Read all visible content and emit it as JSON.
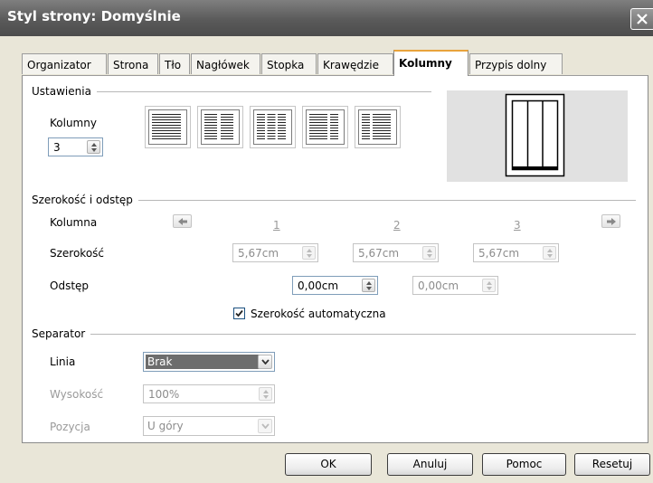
{
  "window": {
    "title": "Styl strony: Domyślnie"
  },
  "tabs": [
    {
      "label": "Organizator"
    },
    {
      "label": "Strona"
    },
    {
      "label": "Tło"
    },
    {
      "label": "Nagłówek"
    },
    {
      "label": "Stopka"
    },
    {
      "label": "Krawędzie"
    },
    {
      "label": "Kolumny",
      "active": true
    },
    {
      "label": "Przypis dolny"
    }
  ],
  "settings": {
    "section": "Ustawienia",
    "columns_label": "Kolumny",
    "columns_value": "3",
    "presets": [
      "1 column",
      "2 columns",
      "3 columns",
      "2 columns left-wide",
      "2 columns right-wide"
    ]
  },
  "width_spacing": {
    "section": "Szerokość i odstęp",
    "column_label": "Kolumna",
    "column_numbers": [
      "1",
      "2",
      "3"
    ],
    "width_label": "Szerokość",
    "widths": [
      "5,67cm",
      "5,67cm",
      "5,67cm"
    ],
    "spacing_label": "Odstęp",
    "spacings": [
      "0,00cm",
      "0,00cm"
    ],
    "auto_width_label": "Szerokość automatyczna",
    "auto_width_checked": true
  },
  "separator": {
    "section": "Separator",
    "line_label": "Linia",
    "line_value": "Brak",
    "height_label": "Wysokość",
    "height_value": "100%",
    "position_label": "Pozycja",
    "position_value": "U góry"
  },
  "buttons": {
    "ok": "OK",
    "cancel": "Anuluj",
    "help": "Pomoc",
    "reset": "Resetuj"
  },
  "colors": {
    "titlebar": "#5a5a5a",
    "dialog_bg": "#e9e6d8",
    "active_tab_accent": "#e8a33c",
    "disabled_text": "#9a9a9a"
  }
}
